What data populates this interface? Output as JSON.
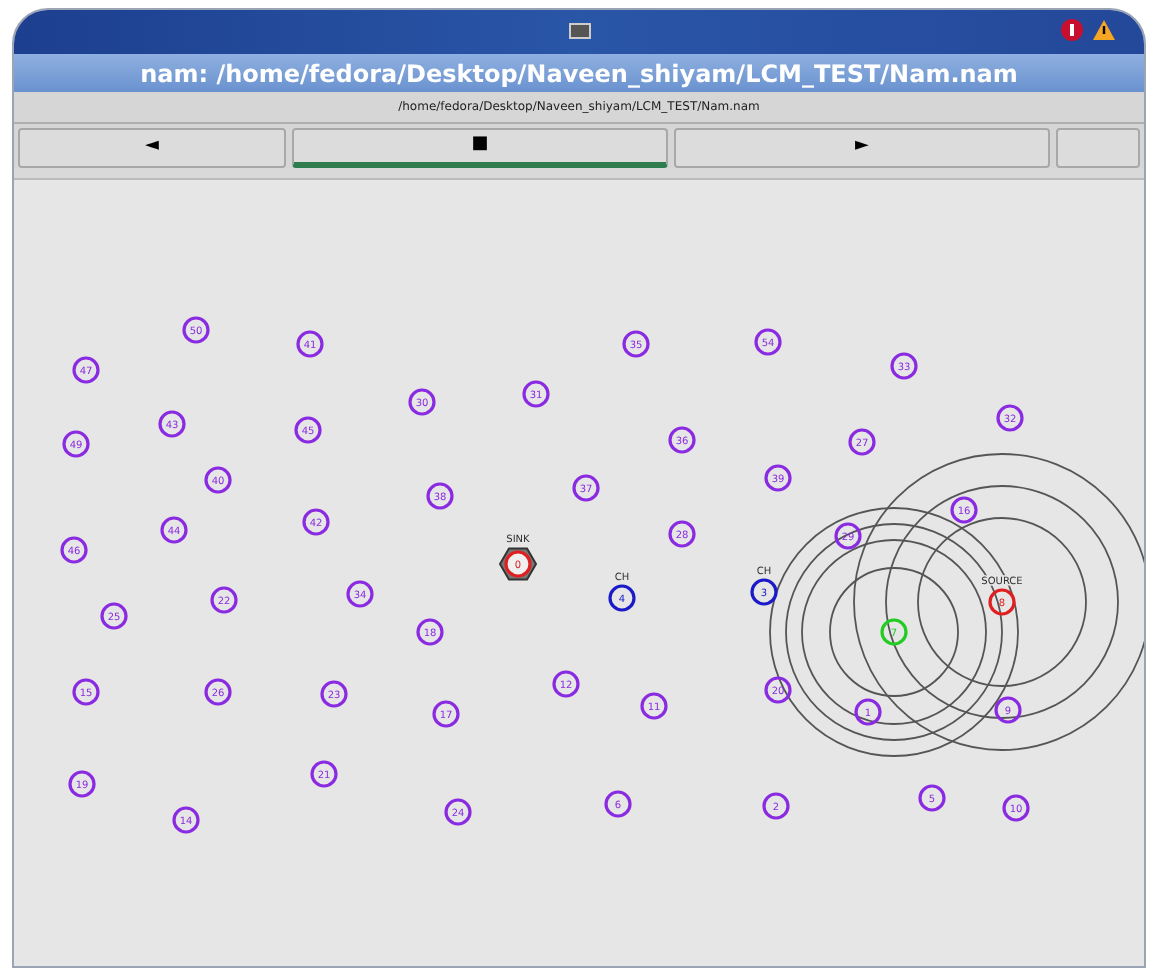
{
  "window": {
    "title": "nam: /home/fedora/Desktop/Naveen_shiyam/LCM_TEST/Nam.nam"
  },
  "subtitle": "/home/fedora/Desktop/Naveen_shiyam/LCM_TEST/Nam.nam",
  "controls": [
    {
      "label": "◄",
      "selected": false
    },
    {
      "label": "■",
      "selected": true
    },
    {
      "label": "►",
      "selected": false
    },
    {
      "selected": false
    }
  ],
  "nodes": [
    {
      "kind": "normal",
      "id": "50"
    },
    {
      "kind": "normal",
      "id": "41"
    },
    {
      "kind": "normal",
      "id": "47"
    },
    {
      "kind": "normal",
      "id": "43"
    },
    {
      "kind": "normal",
      "id": "45"
    },
    {
      "kind": "normal",
      "id": "49"
    },
    {
      "kind": "normal",
      "id": "40"
    },
    {
      "kind": "normal",
      "id": "44"
    },
    {
      "kind": "normal",
      "id": "42"
    },
    {
      "kind": "normal",
      "id": "46"
    },
    {
      "kind": "normal",
      "id": "25"
    },
    {
      "kind": "normal",
      "id": "22"
    },
    {
      "kind": "normal",
      "id": "34"
    },
    {
      "kind": "normal",
      "id": "15"
    },
    {
      "kind": "normal",
      "id": "26"
    },
    {
      "kind": "normal",
      "id": "23"
    },
    {
      "kind": "normal",
      "id": "19"
    },
    {
      "kind": "normal",
      "id": "21"
    },
    {
      "kind": "normal",
      "id": "14"
    },
    {
      "kind": "normal",
      "id": "35"
    },
    {
      "kind": "normal",
      "id": "54"
    },
    {
      "kind": "normal",
      "id": "30"
    },
    {
      "kind": "normal",
      "id": "31"
    },
    {
      "kind": "normal",
      "id": "33"
    },
    {
      "kind": "normal",
      "id": "32"
    },
    {
      "kind": "normal",
      "id": "36"
    },
    {
      "kind": "normal",
      "id": "27"
    },
    {
      "kind": "normal",
      "id": "38"
    },
    {
      "kind": "normal",
      "id": "37"
    },
    {
      "kind": "normal",
      "id": "39"
    },
    {
      "kind": "normal",
      "id": "28"
    },
    {
      "kind": "normal",
      "id": "29"
    },
    {
      "kind": "normal",
      "id": "16"
    },
    {
      "kind": "normal",
      "id": "18"
    },
    {
      "kind": "normal",
      "id": "12"
    },
    {
      "kind": "normal",
      "id": "11"
    },
    {
      "kind": "normal",
      "id": "17"
    },
    {
      "kind": "normal",
      "id": "20"
    },
    {
      "kind": "normal",
      "id": "1"
    },
    {
      "kind": "normal",
      "id": "9"
    },
    {
      "kind": "normal",
      "id": "24"
    },
    {
      "kind": "normal",
      "id": "6"
    },
    {
      "kind": "normal",
      "id": "2"
    },
    {
      "kind": "normal",
      "id": "5"
    },
    {
      "kind": "normal",
      "id": "10"
    },
    {
      "kind": "sink",
      "id": "0",
      "label": "SINK"
    },
    {
      "kind": "cluster_head",
      "id": "4",
      "label": "CH"
    },
    {
      "kind": "cluster_head",
      "id": "3",
      "label": "CH"
    },
    {
      "kind": "target",
      "id": "7"
    },
    {
      "kind": "source",
      "id": "8",
      "label": "SOURCE"
    }
  ]
}
